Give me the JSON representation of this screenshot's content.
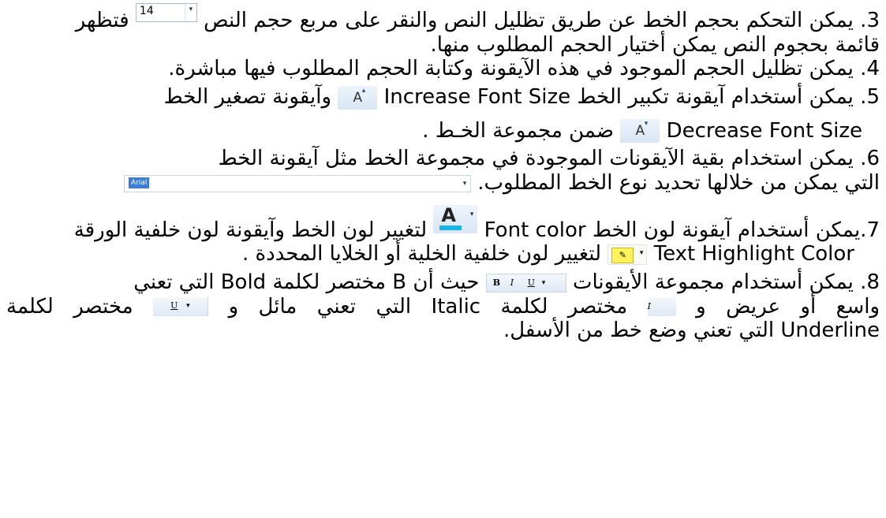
{
  "p3": {
    "l1": "3. يمكن التحكم بحجم الخط عن طريق تظليل النص والنقر على مربع حجم النص",
    "l1_tail": "فتظهر",
    "l2": "قائمة بحجوم النص يمكن أختيار الحجم المطلوب منها."
  },
  "p4": {
    "l1": "4. يمكن تظليل الحجم الموجود في هذه الآيقونة وكتابة الحجم المطلوب فيها مباشرة."
  },
  "p5": {
    "l1_a": "5. يمكن أستخدام آيقونة تكبير الخط",
    "l1_en": "Increase Font Size",
    "l1_b": "وآيقونة تصغير الخط",
    "l2_en": "Decrease Font Size",
    "l2_b": "ضمن مجموعة الخـط ."
  },
  "p6": {
    "l1": "6. يمكن استخدام بقية الآيقونات الموجودة في مجموعة الخط مثل آيقونة الخط",
    "l2": "التي يمكن من خلالها تحديد نوع الخط المطلوب."
  },
  "p7": {
    "l1_a": "7.يمكن أستخدام آيقونة لون الخط",
    "l1_en": "Font color",
    "l1_b": "لتغيير لون الخط وآيقونة لون خلفية الورقة",
    "l2_en": "Text Highlight Color",
    "l2_b": "لتغيير لون خلفية الخلية أو الخلايا المحددة ."
  },
  "p8": {
    "l1_a": "8. يمكن أستخدام مجموعة الأيقونات",
    "l1_b": "حيث أن B مختصر لكلمة",
    "l1_en": "Bold",
    "l1_c": "التي تعني",
    "l2_a": "واسع أو عريض و",
    "l2_b": "مختصر لكلمة",
    "l2_en": "Italic",
    "l2_c": "التي تعني مائل و",
    "l2_d": "مختصر لكلمة",
    "l3_en": "Underline",
    "l3_b": "التي تعني وضع خط من الأسفل."
  },
  "icons": {
    "font_size_value": "14",
    "font_grow_label": "A",
    "font_shrink_label": "A",
    "font_name_value": "Arial",
    "font_color_label": "A",
    "bold_label": "B",
    "italic_label": "I",
    "underline_label": "U",
    "font_color_swatch": "#1ab3e6",
    "highlight_swatch": "#fff25a"
  }
}
